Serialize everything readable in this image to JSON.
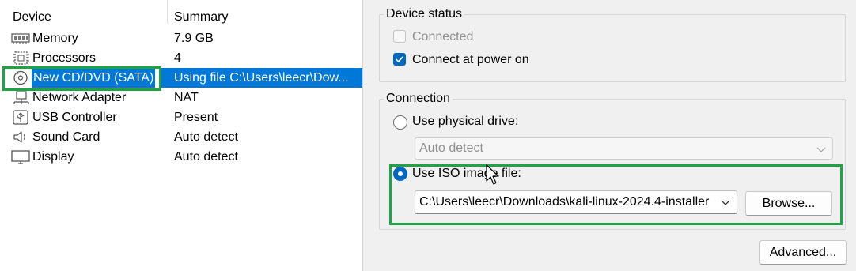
{
  "device_list": {
    "headers": {
      "device": "Device",
      "summary": "Summary"
    },
    "items": [
      {
        "name": "Memory",
        "summary": "7.9 GB",
        "icon": "memory-icon"
      },
      {
        "name": "Processors",
        "summary": "4",
        "icon": "processor-icon"
      },
      {
        "name": "New CD/DVD (SATA)",
        "summary": "Using file C:\\Users\\leecr\\Dow...",
        "icon": "cd-dvd-icon",
        "selected": true
      },
      {
        "name": "Network Adapter",
        "summary": "NAT",
        "icon": "network-adapter-icon"
      },
      {
        "name": "USB Controller",
        "summary": "Present",
        "icon": "usb-icon"
      },
      {
        "name": "Sound Card",
        "summary": "Auto detect",
        "icon": "speaker-icon"
      },
      {
        "name": "Display",
        "summary": "Auto detect",
        "icon": "monitor-icon"
      }
    ]
  },
  "device_status": {
    "title": "Device status",
    "connected": {
      "label": "Connected",
      "checked": false,
      "enabled": false
    },
    "connect_at_power_on": {
      "label": "Connect at power on",
      "checked": true,
      "enabled": true
    }
  },
  "connection": {
    "title": "Connection",
    "physical_drive": {
      "label": "Use physical drive:",
      "selected": false,
      "value": "Auto detect"
    },
    "iso_image": {
      "label": "Use ISO image file:",
      "selected": true,
      "path": "C:\\Users\\leecr\\Downloads\\kali-linux-2024.4-installer",
      "browse_label": "Browse..."
    }
  },
  "advanced_label": "Advanced...",
  "colors": {
    "accent": "#0067c0",
    "selection": "#0078d7",
    "highlight_box": "#1ea446"
  }
}
